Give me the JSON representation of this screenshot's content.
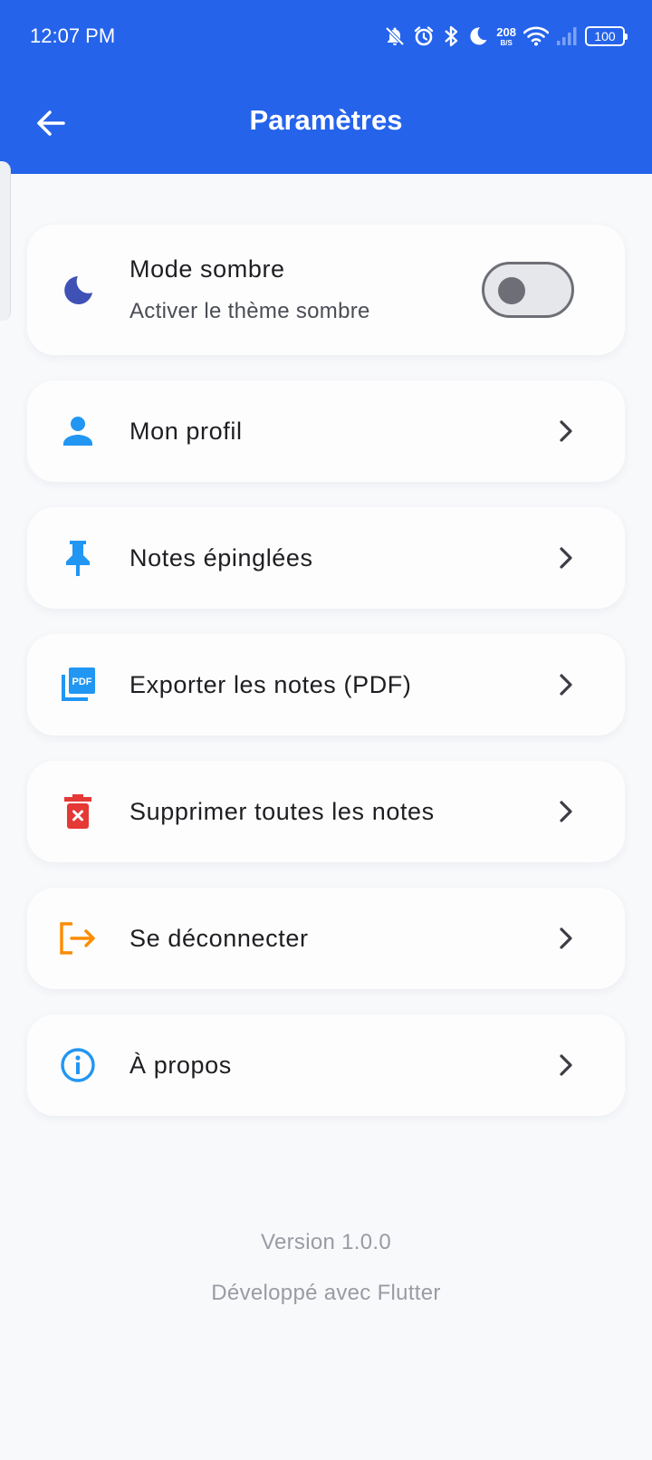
{
  "status_bar": {
    "time": "12:07 PM",
    "net_speed_value": "208",
    "net_speed_unit": "B/S",
    "battery": "100"
  },
  "header": {
    "title": "Paramètres"
  },
  "settings": {
    "dark_mode": {
      "label": "Mode sombre",
      "subtitle": "Activer le thème sombre",
      "enabled": false
    },
    "items": [
      {
        "label": "Mon profil",
        "icon": "person-icon",
        "color": "#2196f3"
      },
      {
        "label": "Notes épinglées",
        "icon": "pin-icon",
        "color": "#2196f3"
      },
      {
        "label": "Exporter les notes (PDF)",
        "icon": "pdf-icon",
        "color": "#2196f3"
      },
      {
        "label": "Supprimer toutes les notes",
        "icon": "delete-icon",
        "color": "#e53935"
      },
      {
        "label": "Se déconnecter",
        "icon": "logout-icon",
        "color": "#fb8c00"
      },
      {
        "label": "À propos",
        "icon": "info-icon",
        "color": "#2196f3"
      }
    ]
  },
  "footer": {
    "version": "Version 1.0.0",
    "built_with": "Développé avec Flutter"
  },
  "colors": {
    "app_bar": "#2563eb",
    "background": "#f8f9fb",
    "moon": "#3f51b5"
  }
}
